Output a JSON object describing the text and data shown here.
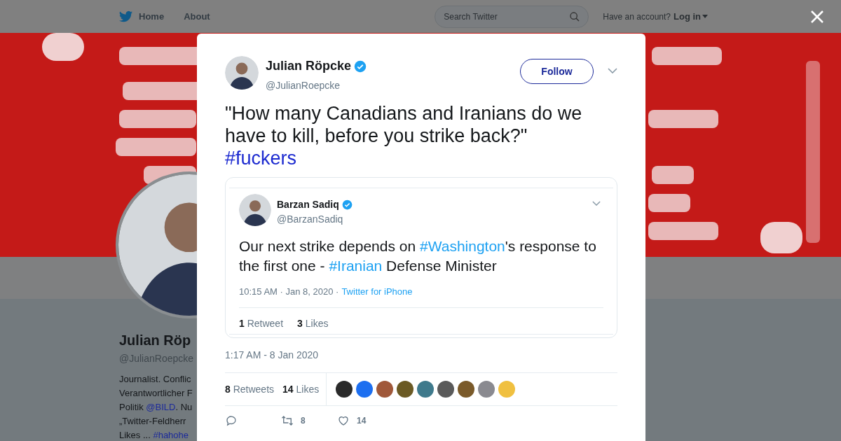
{
  "nav": {
    "items": [
      {
        "label": "Home",
        "kind": "home"
      },
      {
        "label": "About",
        "kind": "plain"
      }
    ],
    "search": {
      "placeholder": "Search Twitter"
    },
    "account": {
      "prompt": "Have an account?",
      "login": "Log in"
    }
  },
  "profile": {
    "name": "Julian Röp",
    "handle": "@JulianRoepcke",
    "bio": [
      [
        {
          "text": "Journalist. Conflic",
          "kind": "plain"
        }
      ],
      [
        {
          "text": "Verantwortlicher F",
          "kind": "plain"
        }
      ],
      [
        {
          "text": "Politik ",
          "kind": "plain"
        },
        {
          "text": "@BILD",
          "kind": "link"
        },
        {
          "text": ". Nu",
          "kind": "plain"
        }
      ],
      [
        {
          "text": "„Twitter-Feldherr",
          "kind": "plain"
        }
      ],
      [
        {
          "text": "Likes ... ",
          "kind": "plain"
        },
        {
          "text": "#hahohe",
          "kind": "link"
        }
      ]
    ]
  },
  "tweet": {
    "name": "Julian Röpcke",
    "verified": true,
    "handle": "@JulianRoepcke",
    "follow": "Follow",
    "text": [
      {
        "text": "\"How many Canadians and Iranians do we have to kill, before you strike back?\"\n",
        "kind": "plain"
      },
      {
        "text": "#fuckers",
        "kind": "hashtag"
      }
    ],
    "embed": {
      "name": "Barzan Sadiq",
      "verified": true,
      "handle": "@BarzanSadiq",
      "text": [
        {
          "text": "Our next strike depends on ",
          "kind": "plain"
        },
        {
          "text": "#Washington",
          "kind": "hashtag"
        },
        {
          "text": "'s response to the first one - ",
          "kind": "plain"
        },
        {
          "text": "#Iranian",
          "kind": "hashtag"
        },
        {
          "text": " Defense Minister",
          "kind": "plain"
        }
      ],
      "time": "10:15 AM · Jan 8, 2020 ·",
      "source": "Twitter for iPhone",
      "stats": [
        {
          "count": "1",
          "label": "Retweet"
        },
        {
          "count": "3",
          "label": "Likes"
        }
      ]
    },
    "timestamp": "1:17 AM - 8 Jan 2020",
    "stats": [
      {
        "count": "8",
        "label": "Retweets"
      },
      {
        "count": "14",
        "label": "Likes"
      }
    ],
    "likers": [
      {
        "color": "#2a2a2a"
      },
      {
        "color": "#1d6ff0"
      },
      {
        "color": "#a0583a"
      },
      {
        "color": "#6b5a24"
      },
      {
        "color": "#3f7a8c"
      },
      {
        "color": "#5a5a5a"
      },
      {
        "color": "#7a5a2a"
      },
      {
        "color": "#8a8a90"
      },
      {
        "color": "#f0c040"
      }
    ],
    "actions": [
      {
        "kind": "reply"
      },
      {
        "kind": "retweet",
        "count": "8"
      },
      {
        "kind": "like",
        "count": "14"
      }
    ]
  }
}
